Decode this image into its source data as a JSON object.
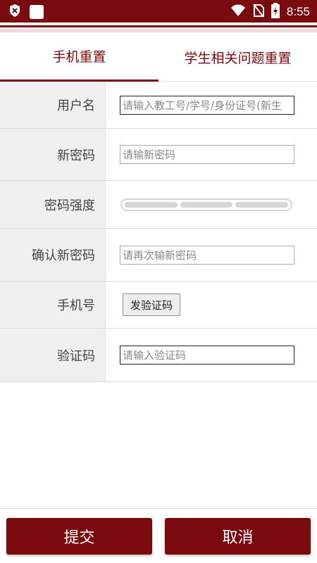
{
  "status_bar": {
    "time": "8:55",
    "icons": [
      "shield-x-icon",
      "app-square-icon",
      "wifi-icon",
      "no-sim-icon",
      "battery-charging-icon"
    ]
  },
  "tabs": [
    {
      "label": "手机重置",
      "active": true
    },
    {
      "label": "学生相关问题重置",
      "active": false
    }
  ],
  "form": {
    "username": {
      "label": "用户名",
      "placeholder": "请输入教工号/学号/身份证号(新生"
    },
    "new_password": {
      "label": "新密码",
      "placeholder": "请输新密码"
    },
    "strength": {
      "label": "密码强度",
      "level": 0
    },
    "confirm_password": {
      "label": "确认新密码",
      "placeholder": "请再次输新密码"
    },
    "phone": {
      "label": "手机号",
      "button_label": "发验证码"
    },
    "code": {
      "label": "验证码",
      "placeholder": "请输入验证码"
    }
  },
  "actions": {
    "submit_label": "提交",
    "cancel_label": "取消"
  },
  "colors": {
    "accent": "#7a0a0d",
    "stripe_light": "#f2dadb",
    "label_bg": "#f0f0f0"
  }
}
